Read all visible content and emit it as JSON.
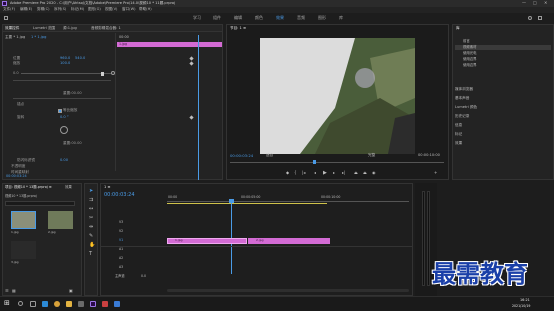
{
  "app": {
    "title": "Adobe Premiere Pro 2020 - C:\\用户\\Ahtsoj\\文档\\Adobe\\Premiere Pro\\14.0\\视频10 * 11题.prproj"
  },
  "menu": [
    "文件(F)",
    "编辑(E)",
    "剪辑(C)",
    "序列(S)",
    "标记(M)",
    "图形(G)",
    "视图(V)",
    "窗口(W)",
    "帮助(H)"
  ],
  "workspaces": [
    "学习",
    "组件",
    "编辑",
    "颜色",
    "效果",
    "音频",
    "图形",
    "库"
  ],
  "active_workspace": "效果",
  "effect_controls": {
    "tabs": [
      "效果控件",
      "Lumetri 范围",
      "源:1.jpg",
      "音频剪辑混合器: 1"
    ],
    "clip_label": "主要 * 1.jpg",
    "seq_label": "1 * 1.jpg",
    "ruler_time": "00:00",
    "clip_bar": "1.jpg",
    "rows": [
      {
        "label": "位置",
        "v1": "960.0",
        "v2": "540.0"
      },
      {
        "label": "缩放",
        "v1": "100.0",
        "v2": ""
      },
      {
        "label": "",
        "v1": "0.0",
        "v2": ""
      },
      {
        "label": "",
        "v1": "重置:00.00",
        "v2": ""
      },
      {
        "label": "锚点",
        "v1": "",
        "v2": ""
      },
      {
        "label": "",
        "v1": "等比缩放",
        "v2": ""
      },
      {
        "label": "旋转",
        "v1": "0.0 °",
        "v2": ""
      },
      {
        "label": "",
        "v1": "重置:00.00",
        "v2": ""
      },
      {
        "label": "防闪烁滤镜",
        "v1": "0.00",
        "v2": ""
      },
      {
        "label": "不透明度",
        "v1": "",
        "v2": ""
      },
      {
        "label": "时间重映射",
        "v1": "",
        "v2": ""
      }
    ],
    "footer_time": "00:00:03:24"
  },
  "program": {
    "title": "节目: 1 ≡",
    "timecode": "00:00:03:24",
    "fit": "适合",
    "quality": "完整",
    "duration": "00:00:10:00"
  },
  "library": {
    "title": "库",
    "items": [
      "前言",
      "视频素材",
      "使用光电",
      "使用边界",
      "使用边界"
    ],
    "sections": [
      "媒体浏览器",
      "基本声音",
      "Lumetri 颜色",
      "历史记录",
      "信息",
      "标记",
      "效果"
    ]
  },
  "project": {
    "tabs": [
      "项目: 视频10 * 13题.prproj ≡",
      "效果"
    ],
    "path": "视频10 * 13题.prproj",
    "items": [
      "1.jpg",
      "2.jpg",
      "3.jpg"
    ]
  },
  "timeline": {
    "tab": "1 ≡",
    "timecode": "00:00:03:24",
    "ruler": [
      "00:00",
      "00:00:05:00",
      "00:00:10:00"
    ],
    "tracks": [
      "V3",
      "V2",
      "V1",
      "A1",
      "A2",
      "A3",
      "主声道"
    ],
    "master_value": "0.0",
    "clips": [
      "1.jpg",
      "2.jpg"
    ]
  },
  "taskbar": {
    "time": "16:21",
    "date": "2021/10/19"
  },
  "watermark": "最需教育",
  "colors": {
    "accent": "#4a9be6",
    "clip": "#d36bd4",
    "playhead": "#4a9be6"
  }
}
